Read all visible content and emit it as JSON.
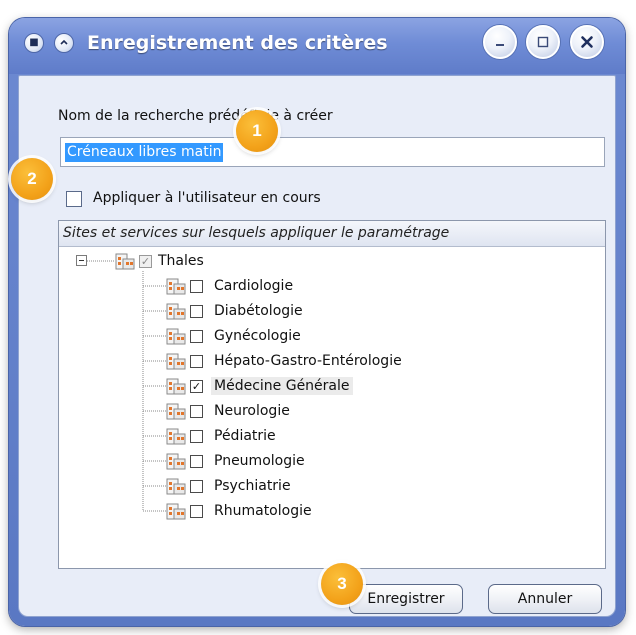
{
  "window": {
    "title": "Enregistrement des critères"
  },
  "form": {
    "name_label": "Nom de la recherche prédéfinie à créer",
    "name_value": "Créneaux libres matin",
    "apply_label": "Appliquer à l'utilisateur en cours",
    "apply_checked": false
  },
  "tree": {
    "header": "Sites et services sur lesquels appliquer le paramétrage",
    "root": {
      "label": "Thales",
      "checked": true,
      "disabled": true,
      "expanded": true
    },
    "children": [
      {
        "label": "Cardiologie",
        "checked": false
      },
      {
        "label": "Diabétologie",
        "checked": false
      },
      {
        "label": "Gynécologie",
        "checked": false
      },
      {
        "label": "Hépato-Gastro-Entérologie",
        "checked": false
      },
      {
        "label": "Médecine Générale",
        "checked": true
      },
      {
        "label": "Neurologie",
        "checked": false
      },
      {
        "label": "Pédiatrie",
        "checked": false
      },
      {
        "label": "Pneumologie",
        "checked": false
      },
      {
        "label": "Psychiatrie",
        "checked": false
      },
      {
        "label": "Rhumatologie",
        "checked": false
      }
    ]
  },
  "buttons": {
    "save": "Enregistrer",
    "cancel": "Annuler"
  },
  "callouts": [
    "1",
    "2",
    "3"
  ],
  "colors": {
    "window_frame": "#6d8ad2",
    "client_bg": "#e8edf8",
    "selection": "#3399ff",
    "callout": "#f3a21a"
  },
  "icons": {
    "tree_node": "hospital-icon",
    "checkbox_checked": "✓"
  }
}
